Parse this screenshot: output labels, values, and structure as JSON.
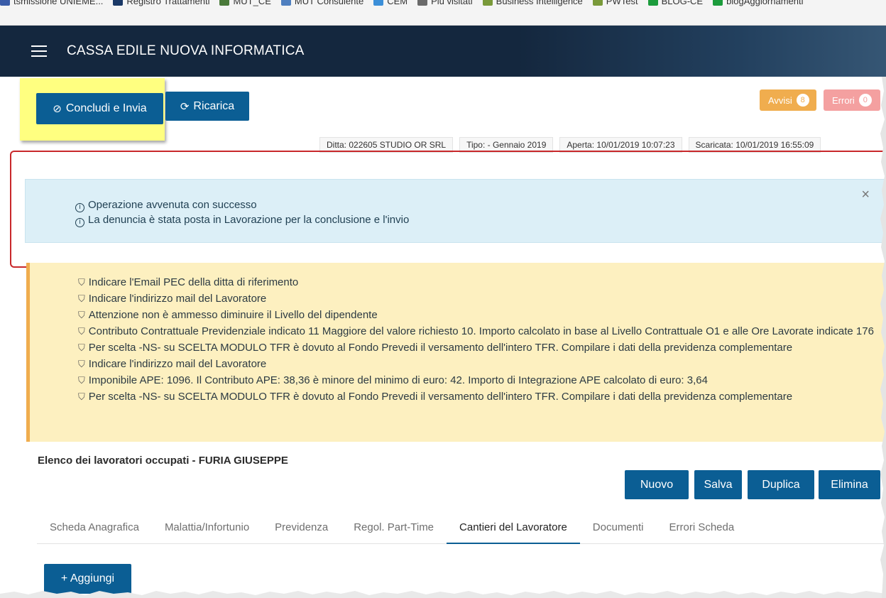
{
  "bookmarks": [
    {
      "label": "tsmissione UNIEME...",
      "icon": "bookmark-icon",
      "color": "#3a5ca8"
    },
    {
      "label": "Registro Trattamenti",
      "icon": "folder-icon",
      "color": "#1a3866"
    },
    {
      "label": "MUT_CE",
      "icon": "globe-icon",
      "color": "#4a7a3a"
    },
    {
      "label": "MUT Consulente",
      "icon": "page-icon",
      "color": "#4f7fbf"
    },
    {
      "label": "CEM",
      "icon": "circle-icon",
      "color": "#3c8fd8"
    },
    {
      "label": "Più visitati",
      "icon": "star-icon",
      "color": "#6a6a6a"
    },
    {
      "label": "Business Intelligence",
      "icon": "chart-icon",
      "color": "#7a9a3a"
    },
    {
      "label": "PWTest",
      "icon": "chart-icon",
      "color": "#7a9a3a"
    },
    {
      "label": "BLOG-CE",
      "icon": "page-icon",
      "color": "#1c9c3c"
    },
    {
      "label": "blogAggiornamenti",
      "icon": "page-icon",
      "color": "#1c9c3c"
    }
  ],
  "header": {
    "title": "CASSA EDILE NUOVA INFORMATICA",
    "brand_color": "#14273e"
  },
  "toolbar": {
    "concludi_label": "Concludi e Invia",
    "ricarica_label": "Ricarica",
    "avvisi_label": "Avvisi",
    "avvisi_count": "8",
    "errori_label": "Errori",
    "errori_count": "0",
    "accent_color": "#0b5e94"
  },
  "info_tags": [
    "Ditta: 022605 STUDIO OR SRL",
    "Tipo: - Gennaio 2019",
    "Aperta: 10/01/2019 10:07:23",
    "Scaricata: 10/01/2019 16:55:09"
  ],
  "success_alert": {
    "messages": [
      "Operazione avvenuta con successo",
      "La denuncia è stata posta in Lavorazione per la conclusione e l'invio"
    ],
    "close": "×"
  },
  "warnings": [
    "Indicare l'Email PEC della ditta di riferimento",
    "Indicare l'indirizzo mail del Lavoratore",
    "Attenzione non è ammesso diminuire il Livello del dipendente",
    "Contributo Contrattuale Previdenziale indicato 11 Maggiore del valore richiesto 10. Importo calcolato in base al Livello Contrattuale O1 e alle Ore Lavorate indicate 176",
    "Per scelta -NS- su SCELTA MODULO TFR è dovuto al Fondo Prevedi il versamento dell'intero TFR. Compilare i dati della previdenza complementare",
    "Indicare l'indirizzo mail del Lavoratore",
    "Imponibile APE: 1096. Il Contributo APE: 38,36 è minore del minimo di euro: 42. Importo di Integrazione APE calcolato di euro: 3,64",
    "Per scelta -NS- su SCELTA MODULO TFR è dovuto al Fondo Prevedi il versamento dell'intero TFR. Compilare i dati della previdenza complementare"
  ],
  "worker": {
    "title": "Elenco dei lavoratori occupati - FURIA GIUSEPPE",
    "actions": {
      "nuovo": "Nuovo",
      "salva": "Salva",
      "duplica": "Duplica",
      "elimina": "Elimina"
    },
    "tabs": [
      "Scheda Anagrafica",
      "Malattia/Infortunio",
      "Previdenza",
      "Regol. Part-Time",
      "Cantieri del Lavoratore",
      "Documenti",
      "Errori Scheda"
    ],
    "active_tab": "Cantieri del Lavoratore",
    "add_label": "+ Aggiungi"
  }
}
